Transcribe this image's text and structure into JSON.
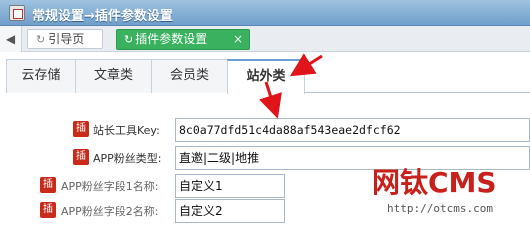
{
  "window": {
    "title": "常规设置→插件参数设置",
    "icon": "window-app-icon"
  },
  "tabbar": {
    "prev_icon": "◀",
    "tabs": [
      {
        "label": "引导页",
        "icon": "reload-icon"
      },
      {
        "label": "插件参数设置",
        "icon": "reload-icon",
        "close": "×"
      }
    ]
  },
  "section_tabs": [
    {
      "label": "云存储"
    },
    {
      "label": "文章类"
    },
    {
      "label": "会员类"
    },
    {
      "label": "站外类",
      "active": true
    }
  ],
  "form": {
    "rows": [
      {
        "badge": "插",
        "label": "站长工具Key:",
        "value": "8c0a77dfd51c4da88af543eae2dfcf62"
      },
      {
        "badge": "插",
        "label": "APP粉丝类型:",
        "value": "直邀|二级|地推"
      },
      {
        "badge": "插",
        "label": "APP粉丝字段1名称:",
        "value": "自定义1"
      },
      {
        "badge": "插",
        "label": "APP粉丝字段2名称:",
        "value": "自定义2"
      }
    ]
  },
  "watermark": {
    "logo": "网钛CMS",
    "url": "http://otcms.com"
  },
  "colors": {
    "accent_green": "#39b15f",
    "badge_red": "#c92a1a",
    "arrow_red": "#e0141b",
    "title_bar_blue": "#6f9fcb"
  }
}
